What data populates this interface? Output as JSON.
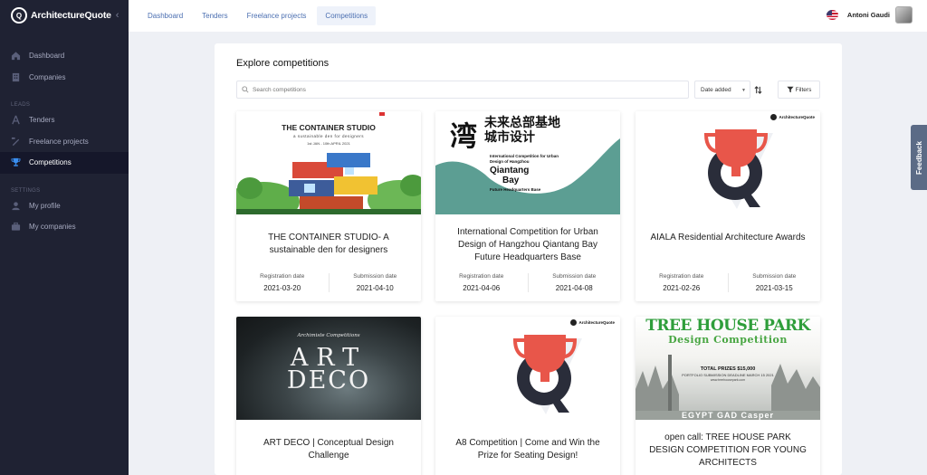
{
  "app": {
    "name": "ArchitectureQuote"
  },
  "sidebar": {
    "items_main": [
      {
        "label": "Dashboard",
        "icon": "home-icon"
      },
      {
        "label": "Companies",
        "icon": "building-icon"
      }
    ],
    "section_leads": "LEADS",
    "items_leads": [
      {
        "label": "Tenders",
        "icon": "compass-icon"
      },
      {
        "label": "Freelance projects",
        "icon": "pen-ruler-icon"
      },
      {
        "label": "Competitions",
        "icon": "trophy-icon",
        "active": true
      }
    ],
    "section_settings": "SETTINGS",
    "items_settings": [
      {
        "label": "My profile",
        "icon": "user-icon"
      },
      {
        "label": "My companies",
        "icon": "briefcase-icon"
      }
    ]
  },
  "topbar": {
    "tabs": [
      "Dashboard",
      "Tenders",
      "Freelance projects",
      "Competitions"
    ],
    "active_tab": "Competitions",
    "user_name": "Antoni Gaudi"
  },
  "main": {
    "title": "Explore competitions",
    "search_placeholder": "Search competitions",
    "sort_label": "Date added",
    "filters_label": "Filters"
  },
  "cards": [
    {
      "title": "THE CONTAINER STUDIO- A sustainable den for designers",
      "reg_label": "Registration date",
      "reg_date": "2021-03-20",
      "sub_label": "Submission date",
      "sub_date": "2021-04-10",
      "img": {
        "t1": "THE CONTAINER STUDIO",
        "t2": "a sustainable den for designers",
        "t3": "1st JAN - 10th APRIL 2021"
      }
    },
    {
      "title": "International Competition for Urban Design of Hangzhou Qiantang Bay Future Headquarters Base",
      "reg_label": "Registration date",
      "reg_date": "2021-04-06",
      "sub_label": "Submission date",
      "sub_date": "2021-04-08",
      "img": {
        "big": "湾",
        "cn1": "未来总部基地",
        "cn2": "城市设计",
        "en1": "International Competition for Urban Design of Hangzhou",
        "en2a": "Qiantang",
        "en2b": "Bay",
        "en3": "Future Headquarters Base"
      }
    },
    {
      "title": "AIALA Residential Architecture Awards",
      "reg_label": "Registration date",
      "reg_date": "2021-02-26",
      "sub_label": "Submission date",
      "sub_date": "2021-03-15",
      "img": {
        "brand": "ArchitectureQuote"
      }
    },
    {
      "title": "ART DECO | Conceptual Design Challenge",
      "img": {
        "small": "Archimiste Competitions",
        "big1": "ART",
        "big2": "DECO"
      }
    },
    {
      "title": "A8 Competition | Come and Win the Prize for Seating Design!",
      "img": {
        "brand": "ArchitectureQuote"
      }
    },
    {
      "title": "open call: TREE HOUSE PARK DESIGN COMPETITION FOR YOUNG ARCHITECTS",
      "img": {
        "h1": "TREE HOUSE PARK",
        "h2": "Design Competition",
        "p1": "TOTAL PRIZES $15,000",
        "p2": "PORTFOLIO SUBMISSION DEADLINE MARCH 15 2021",
        "p3": "www.treehousepark.com",
        "sponsors": "EGYPT GAD Casper"
      }
    }
  ],
  "feedback_label": "Feedback",
  "colors": {
    "sidebar_bg": "#1f2233",
    "accent": "#4b6fb1",
    "trophy_red": "#e8564a"
  }
}
